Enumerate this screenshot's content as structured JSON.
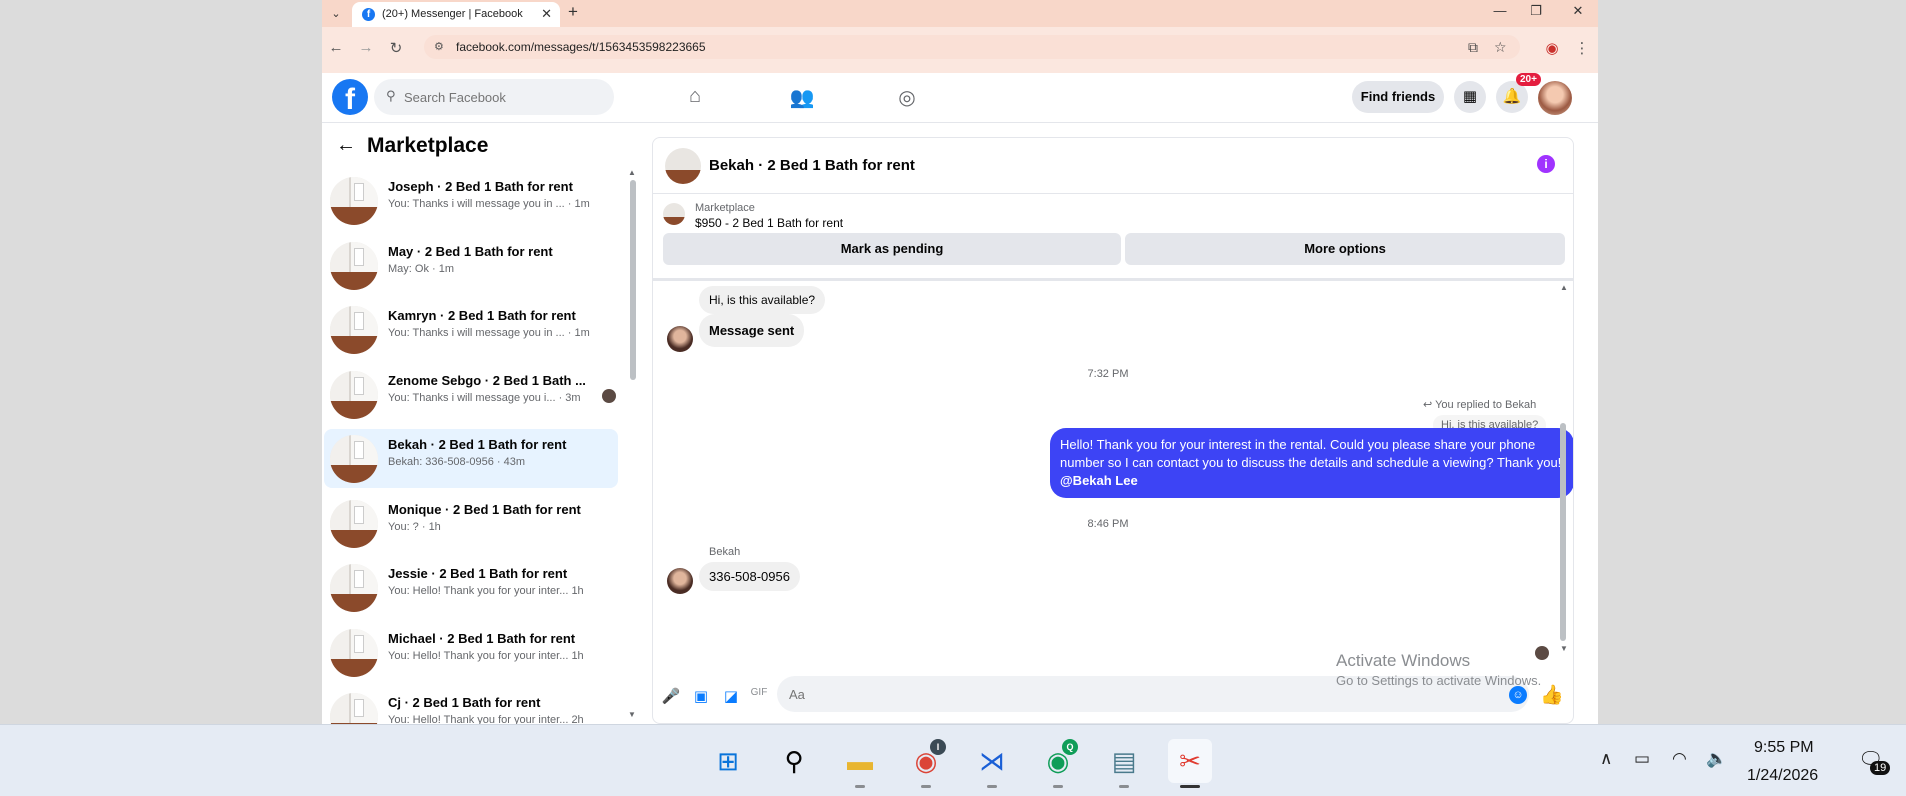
{
  "browser": {
    "tab_title": "(20+) Messenger | Facebook",
    "url": "facebook.com/messages/t/1563453598223665"
  },
  "header": {
    "search_placeholder": "Search Facebook",
    "find_friends": "Find friends",
    "notif_badge": "20+"
  },
  "left_panel": {
    "title": "Marketplace",
    "conversations": [
      {
        "name": "Joseph · 2 Bed 1 Bath for rent",
        "snippet": "You: Thanks i will message you in ... · 1m"
      },
      {
        "name": "May · 2 Bed 1 Bath for rent",
        "snippet": "May: Ok · 1m"
      },
      {
        "name": "Kamryn · 2 Bed 1 Bath for rent",
        "snippet": "You: Thanks i will message you in ... · 1m"
      },
      {
        "name": "Zenome Sebgo · 2 Bed 1 Bath ...",
        "snippet": "You: Thanks i will message you i... · 3m"
      },
      {
        "name": "Bekah · 2 Bed 1 Bath for rent",
        "snippet": "Bekah: 336-508-0956 · 43m"
      },
      {
        "name": "Monique · 2 Bed 1 Bath for rent",
        "snippet": "You: ? · 1h"
      },
      {
        "name": "Jessie · 2 Bed 1 Bath for rent",
        "snippet": "You: Hello! Thank you for your inter... 1h"
      },
      {
        "name": "Michael · 2 Bed 1 Bath for rent",
        "snippet": "You: Hello! Thank you for your inter... 1h"
      },
      {
        "name": "Cj · 2 Bed 1 Bath for rent",
        "snippet": "You: Hello! Thank you for your inter... 2h"
      }
    ]
  },
  "chat": {
    "title": "Bekah · 2 Bed 1 Bath for rent",
    "listing_label": "Marketplace",
    "listing_price": "$950 - 2 Bed 1 Bath for rent",
    "mark_pending": "Mark as pending",
    "more_options": "More options",
    "msg_available": "Hi, is this available?",
    "msg_sent": "Message sent",
    "time1": "7:32 PM",
    "reply_note": "You replied to Bekah",
    "quoted": "Hi, is this available?",
    "out_text": "Hello! Thank you for your interest in the rental. Could you please share your phone number so I can contact you to discuss the details and schedule a viewing? Thank you!",
    "out_mention": "@Bekah Lee",
    "time2": "8:46 PM",
    "sender_name": "Bekah",
    "msg_phone": "336-508-0956",
    "composer_placeholder": "Aa"
  },
  "watermark": {
    "line1": "Activate Windows",
    "line2": "Go to Settings to activate Windows."
  },
  "taskbar": {
    "chrome_badge": "I",
    "chrome2_badge": "Q",
    "time": "9:55 PM",
    "date": "1/24/2026",
    "notif_count": "19"
  }
}
